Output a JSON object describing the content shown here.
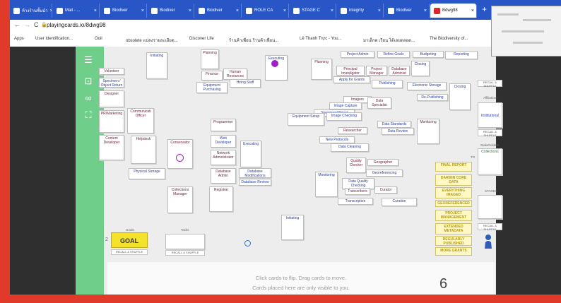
{
  "browser": {
    "tabs": [
      {
        "label": "ห้างร้านชั้นนำ"
      },
      {
        "label": "Mail - ..."
      },
      {
        "label": "Biodiver"
      },
      {
        "label": "Biodiver"
      },
      {
        "label": "Biodiver"
      },
      {
        "label": "ROLE CA"
      },
      {
        "label": "STAGE C"
      },
      {
        "label": "integrity"
      },
      {
        "label": "Biodiver"
      },
      {
        "label": "Bdwg98"
      }
    ],
    "new_tab": "+",
    "url": "playingcards.io/8dwg98",
    "nav": {
      "back": "←",
      "forward": "→",
      "reload": "C"
    },
    "bookmarks": [
      {
        "label": "Apps"
      },
      {
        "label": "User Identification..."
      },
      {
        "label": "Ooil"
      },
      {
        "label": "obsolete แปลงรายละเอียด..."
      },
      {
        "label": "Discover Life"
      },
      {
        "label": "ร้านค้าเพื่อน ร้านค้าเพื่อน..."
      },
      {
        "label": "Lê Thanh Trực - You..."
      },
      {
        "label": "มาเล็กต เรียน ได้เลยตลอด..."
      },
      {
        "label": "The Biodiversity of..."
      }
    ]
  },
  "board": {
    "cards": [
      {
        "text": "Initiating"
      },
      {
        "text": "Planning"
      },
      {
        "text": "Executing"
      },
      {
        "text": "Volunteer"
      },
      {
        "text": "Specimen / Object Return"
      },
      {
        "text": "Designer"
      },
      {
        "text": "PR/Marketing"
      },
      {
        "text": "Communicati Officer"
      },
      {
        "text": "Content Developer"
      },
      {
        "text": "Helpdesk"
      },
      {
        "text": "Conservator"
      },
      {
        "text": "Physical Storage"
      },
      {
        "text": "Collections Manager"
      },
      {
        "text": "Finance"
      },
      {
        "text": "Human Resources"
      },
      {
        "text": "Equipment Purchasing"
      },
      {
        "text": "Hiring Staff"
      },
      {
        "text": "Programmer"
      },
      {
        "text": "Web Developer"
      },
      {
        "text": "Executing"
      },
      {
        "text": "Network Administrator"
      },
      {
        "text": "Database Admin"
      },
      {
        "text": "Database Modifications"
      },
      {
        "text": "Database Review"
      },
      {
        "text": "Registrar"
      },
      {
        "text": "Planning"
      },
      {
        "text": "Project Admin"
      },
      {
        "text": "Refine Goals"
      },
      {
        "text": "Budgeting"
      },
      {
        "text": "Reporting"
      },
      {
        "text": "Principal Investigator"
      },
      {
        "text": "Project Manager"
      },
      {
        "text": "Database Administ"
      },
      {
        "text": "Closing"
      },
      {
        "text": "Apply for Grants"
      },
      {
        "text": "Publishing"
      },
      {
        "text": "Electronic Storage"
      },
      {
        "text": "Closing"
      },
      {
        "text": "Re-Publishing"
      },
      {
        "text": "Imagers"
      },
      {
        "text": "Image Capture"
      },
      {
        "text": "Data Specialist"
      },
      {
        "text": "Specimen/Object"
      },
      {
        "text": "Equipment Setup"
      },
      {
        "text": "Image Checking"
      },
      {
        "text": "Data Standards"
      },
      {
        "text": "Monitoring"
      },
      {
        "text": "Data Review"
      },
      {
        "text": "Researcher"
      },
      {
        "text": "New Protocols"
      },
      {
        "text": "Data Cleaning"
      },
      {
        "text": "Quality Checker"
      },
      {
        "text": "Geographer"
      },
      {
        "text": "Georeferencing"
      },
      {
        "text": "Monitoring"
      },
      {
        "text": "Data Quality Checking"
      },
      {
        "text": "Transcribers"
      },
      {
        "text": "Curator"
      },
      {
        "text": "Transcription"
      },
      {
        "text": "Curation"
      },
      {
        "text": "Initiating"
      }
    ],
    "stages": [
      {
        "text": "FINAL REPORT"
      },
      {
        "text": "DARWIN CORE DATA"
      },
      {
        "text": "EVERYTHING IMAGED"
      },
      {
        "text": "GEOREFERENCED"
      },
      {
        "text": "PROJECT MANAGEMENT"
      },
      {
        "text": "EXTENDED METADATA"
      },
      {
        "text": "REGULARLY PUBLISHED"
      },
      {
        "text": "MORE GRANTS"
      }
    ],
    "right_panel": {
      "affiliations_label": "Affiliations",
      "institutional": "Institutional",
      "stakeholders_label": "Stakeholders",
      "collections": "Collections",
      "stages_label": "STAGES",
      "recall": "RECALL & SHUFFLE",
      "to_label": "TO"
    },
    "goal": {
      "label": "Goals",
      "value": "GOAL",
      "number": "2",
      "recall": "RECALL & SHUFFLE"
    },
    "tasks": {
      "label": "Tasks",
      "recall": "RECALL & SHUFFLE"
    },
    "hint_line1": "Click cards to flip.   Drag cards to move.",
    "hint_line2": "Cards placed here are only visible to you.",
    "counter": "6"
  }
}
